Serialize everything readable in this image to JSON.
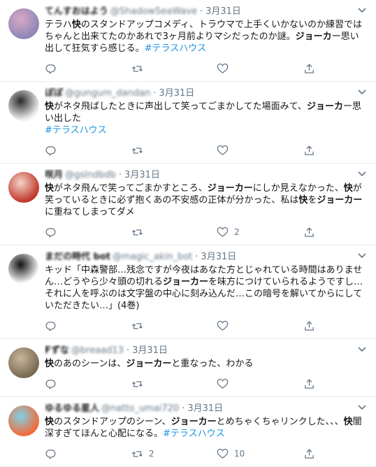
{
  "tweets": [
    {
      "name": "てんすおはよう",
      "handle": "@ShadowSeaWave",
      "date": "3月31日",
      "avatar_colors": [
        "#8f86b8",
        "#d9a9c6"
      ],
      "segments": [
        {
          "t": "テラハ"
        },
        {
          "t": "快",
          "b": true
        },
        {
          "t": "のスタンドアップコメディ、トラウマで上手くいかないのか練習ではちゃんと出来てたのかあれで3ヶ月前よりマシだったのか謎。"
        },
        {
          "t": "ジョーカ",
          "b": true
        },
        {
          "t": "ー思い出して狂気すら感じる。"
        },
        {
          "t": "#テラスハウス",
          "tag": true
        }
      ],
      "likes": "",
      "retweets": ""
    },
    {
      "name": "ぽぽ",
      "handle": "@gungum_dandan",
      "date": "3月31日",
      "avatar_colors": [
        "#f0f0f0",
        "#2b2b2b"
      ],
      "segments": [
        {
          "t": "快",
          "b": true
        },
        {
          "t": "がネタ飛ばしたときに声出して笑ってごまかしてた場面みて、"
        },
        {
          "t": "ジョーカ",
          "b": true
        },
        {
          "t": "ー思い出した"
        },
        {
          "t": "\n"
        },
        {
          "t": "#テラスハウス",
          "tag": true
        }
      ],
      "likes": "",
      "retweets": ""
    },
    {
      "name": "咲月",
      "handle": "@gslndbdb",
      "date": "3月31日",
      "avatar_colors": [
        "#c0392b",
        "#f5d2c8"
      ],
      "segments": [
        {
          "t": "快",
          "b": true
        },
        {
          "t": "がネタ飛んで笑ってごまかすところ、"
        },
        {
          "t": "ジョーカー",
          "b": true
        },
        {
          "t": "にしか見えなかった、"
        },
        {
          "t": "快",
          "b": true
        },
        {
          "t": "が笑っているときに必ず抱くあの不安感の正体が分かった、私は"
        },
        {
          "t": "快",
          "b": true
        },
        {
          "t": "を"
        },
        {
          "t": "ジョーカー",
          "b": true
        },
        {
          "t": "に重ねてしまってダメ"
        }
      ],
      "likes": "2",
      "retweets": ""
    },
    {
      "name": "まだの時代 bot",
      "handle": "@magic_akin_bot",
      "date": "3月31日",
      "avatar_colors": [
        "#ffffff",
        "#111111"
      ],
      "segments": [
        {
          "t": "キッド「中森警部…残念ですが今夜はあなた方とじゃれている時間はありません…どうやら少々頭の切れる"
        },
        {
          "t": "ジョーカー",
          "b": true
        },
        {
          "t": "を味方につけていられるようですし… それに人を呼ぶのは文字盤の中心に刻み込んだ…この暗号を解いてからにしていただきたい…」(4巻)"
        }
      ],
      "likes": "",
      "retweets": ""
    },
    {
      "name": "Fずな",
      "handle": "@breaad13",
      "date": "3月31日",
      "avatar_colors": [
        "#7a6a55",
        "#c9b79a"
      ],
      "segments": [
        {
          "t": "快",
          "b": true
        },
        {
          "t": "のあのシーンは、"
        },
        {
          "t": "ジョーカー",
          "b": true
        },
        {
          "t": "と重なった、わかる"
        }
      ],
      "likes": "",
      "retweets": ""
    },
    {
      "name": "ゆるゆる星人",
      "handle": "@natto_umai720",
      "date": "3月31日",
      "avatar_colors": [
        "#f26b3a",
        "#7fd3e6"
      ],
      "segments": [
        {
          "t": "快",
          "b": true
        },
        {
          "t": "のスタンドアップのシーン、"
        },
        {
          "t": "ジョーカー",
          "b": true
        },
        {
          "t": "とめちゃくちゃリンクした、、、"
        },
        {
          "t": "快",
          "b": true
        },
        {
          "t": "闇深すぎてほんと心配になる。"
        },
        {
          "t": "#テラスハウス",
          "tag": true
        }
      ],
      "likes": "10",
      "retweets": "2"
    }
  ],
  "icons": {
    "reply": "reply-icon",
    "retweet": "retweet-icon",
    "like": "like-icon",
    "share": "share-icon",
    "caret": "chevron-down-icon"
  },
  "colors": {
    "hashtag": "#1b95e0",
    "meta": "#657786",
    "border": "#e6ecf0"
  }
}
